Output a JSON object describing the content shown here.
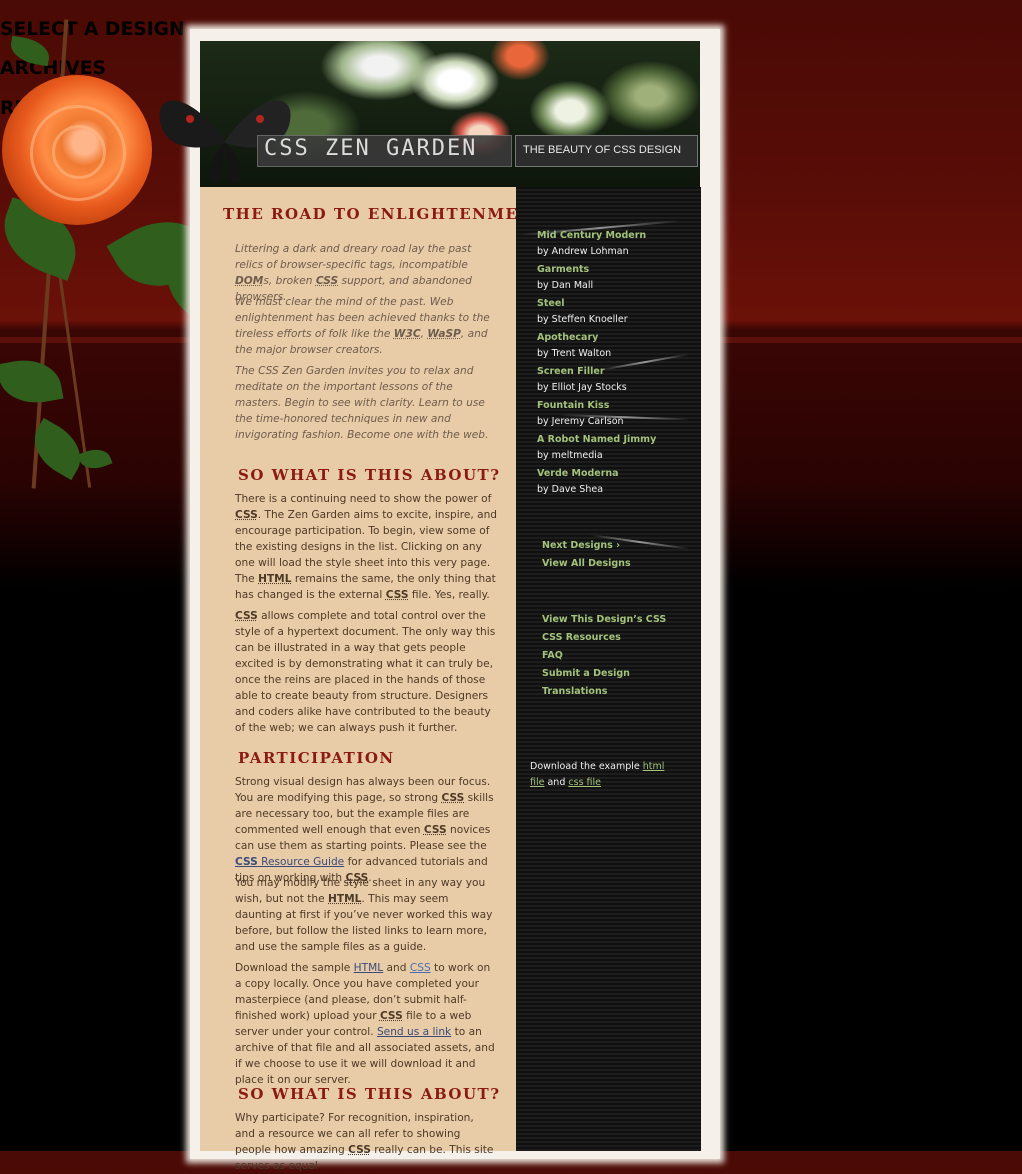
{
  "header": {
    "title": "CSS ZEN GARDEN",
    "subtitle": "THE BEAUTY OF CSS DESIGN"
  },
  "sections": {
    "enlightenment": {
      "heading": "THE ROAD TO ENLIGHTENMENT",
      "p1": [
        "Littering a dark and dreary road lay the past relics of browser-specific tags, incompatible ",
        "DOM",
        "s, broken ",
        "CSS",
        " support, and abandoned browsers."
      ],
      "p2": [
        "We must clear the mind of the past. Web enlightenment has been achieved thanks to the tireless efforts of folk like the ",
        "W3C",
        ", ",
        "WaSP",
        ", and the major browser creators."
      ],
      "p3": "The CSS Zen Garden invites you to relax and meditate on the important lessons of the masters. Begin to see with clarity. Learn to use the time-honored techniques in new and invigorating fashion. Become one with the web."
    },
    "about": {
      "heading": "SO WHAT IS THIS ABOUT?",
      "p1": [
        "There is a continuing need to show the power of ",
        "CSS",
        ". The Zen Garden aims to excite, inspire, and encourage participation. To begin, view some of the existing designs in the list. Clicking on any one will load the style sheet into this very page. The ",
        "HTML",
        " remains the same, the only thing that has changed is the external ",
        "CSS",
        " file. Yes, really."
      ],
      "p2": [
        "CSS",
        " allows complete and total control over the style of a hypertext document. The only way this can be illustrated in a way that gets people excited is by demonstrating what it can truly be, once the reins are placed in the hands of those able to create beauty from structure. Designers and coders alike have contributed to the beauty of the web; we can always push it further."
      ]
    },
    "participation": {
      "heading": "PARTICIPATION",
      "p1": [
        "Strong visual design has always been our focus. You are modifying this page, so strong ",
        "CSS",
        " skills are necessary too, but the example files are commented well enough that even ",
        "CSS",
        " novices can use them as starting points. Please see the ",
        "CSS",
        " Resource Guide",
        " for advanced tutorials and tips on working with ",
        "CSS",
        "."
      ],
      "p2": [
        "You may modify the style sheet in any way you wish, but not the ",
        "HTML",
        ". This may seem daunting at first if you’ve never worked this way before, but follow the listed links to learn more, and use the sample files as a guide."
      ],
      "p3": [
        "Download the sample ",
        "HTML",
        " and ",
        "CSS",
        " to work on a copy locally. Once you have completed your masterpiece (and please, don’t submit half-finished work) upload your ",
        "CSS",
        " file to a web server under your control. ",
        "Send us a link",
        " to an archive of that file and all associated assets, and if we choose to use it we will download it and place it on our server."
      ]
    },
    "about2": {
      "heading": "SO WHAT IS THIS ABOUT?",
      "p1": [
        "Why participate? For recognition, inspiration, and a resource we can all refer to showing people how amazing ",
        "CSS",
        " really can be. This site serves as equal"
      ]
    }
  },
  "sidebar": {
    "select_heading": "SELECT A DESIGN",
    "designs": [
      {
        "name": "Mid Century Modern",
        "by": "by Andrew Lohman"
      },
      {
        "name": "Garments",
        "by": "by Dan Mall"
      },
      {
        "name": "Steel",
        "by": "by Steffen Knoeller"
      },
      {
        "name": "Apothecary",
        "by": "by Trent Walton"
      },
      {
        "name": "Screen Filler",
        "by": "by Elliot Jay Stocks"
      },
      {
        "name": "Fountain Kiss",
        "by": "by Jeremy Carlson"
      },
      {
        "name": "A Robot Named Jimmy",
        "by": "by meltmedia"
      },
      {
        "name": "Verde Moderna",
        "by": "by Dave Shea"
      }
    ],
    "archives_heading": "ARCHIVES",
    "archives": [
      "Next Designs ›",
      "View All Designs"
    ],
    "resources_heading": "RESOURCES",
    "resources": [
      "View This Design’s CSS",
      "CSS Resources",
      "FAQ",
      "Submit a Design",
      "Translations"
    ],
    "download": {
      "pre": "Download the example ",
      "html_link": "html file",
      "mid": " and ",
      "css_link": "css file"
    }
  },
  "colors": {
    "heading": "#8b1a10",
    "link_green": "#a3c27a",
    "main_bg": "#e8cba7",
    "body_text": "#4d3a26"
  }
}
